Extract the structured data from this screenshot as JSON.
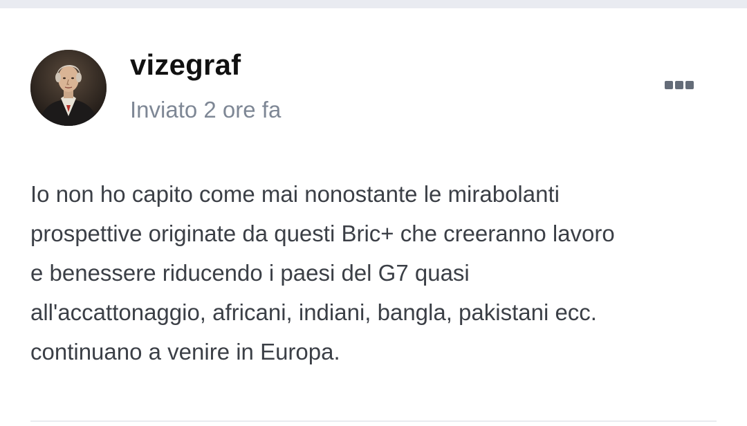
{
  "post": {
    "author": "vizegraf",
    "timestamp": "Inviato 2 ore fa",
    "menu_icon": "more-options-icon",
    "body_lines": [
      "Io non ho capito come mai nonostante le mirabolanti",
      "prospettive originate da questi Bric+ che creeranno lavoro",
      "e benessere riducendo i paesi del G7 quasi",
      "all'accattonaggio, africani, indiani, bangla, pakistani ecc.",
      "continuano a venire in Europa."
    ]
  },
  "colors": {
    "author": "#111111",
    "timestamp": "#7e8795",
    "body": "#3b3f46",
    "menu_dots": "#646c78",
    "top_strip": "#e9ebf1"
  }
}
